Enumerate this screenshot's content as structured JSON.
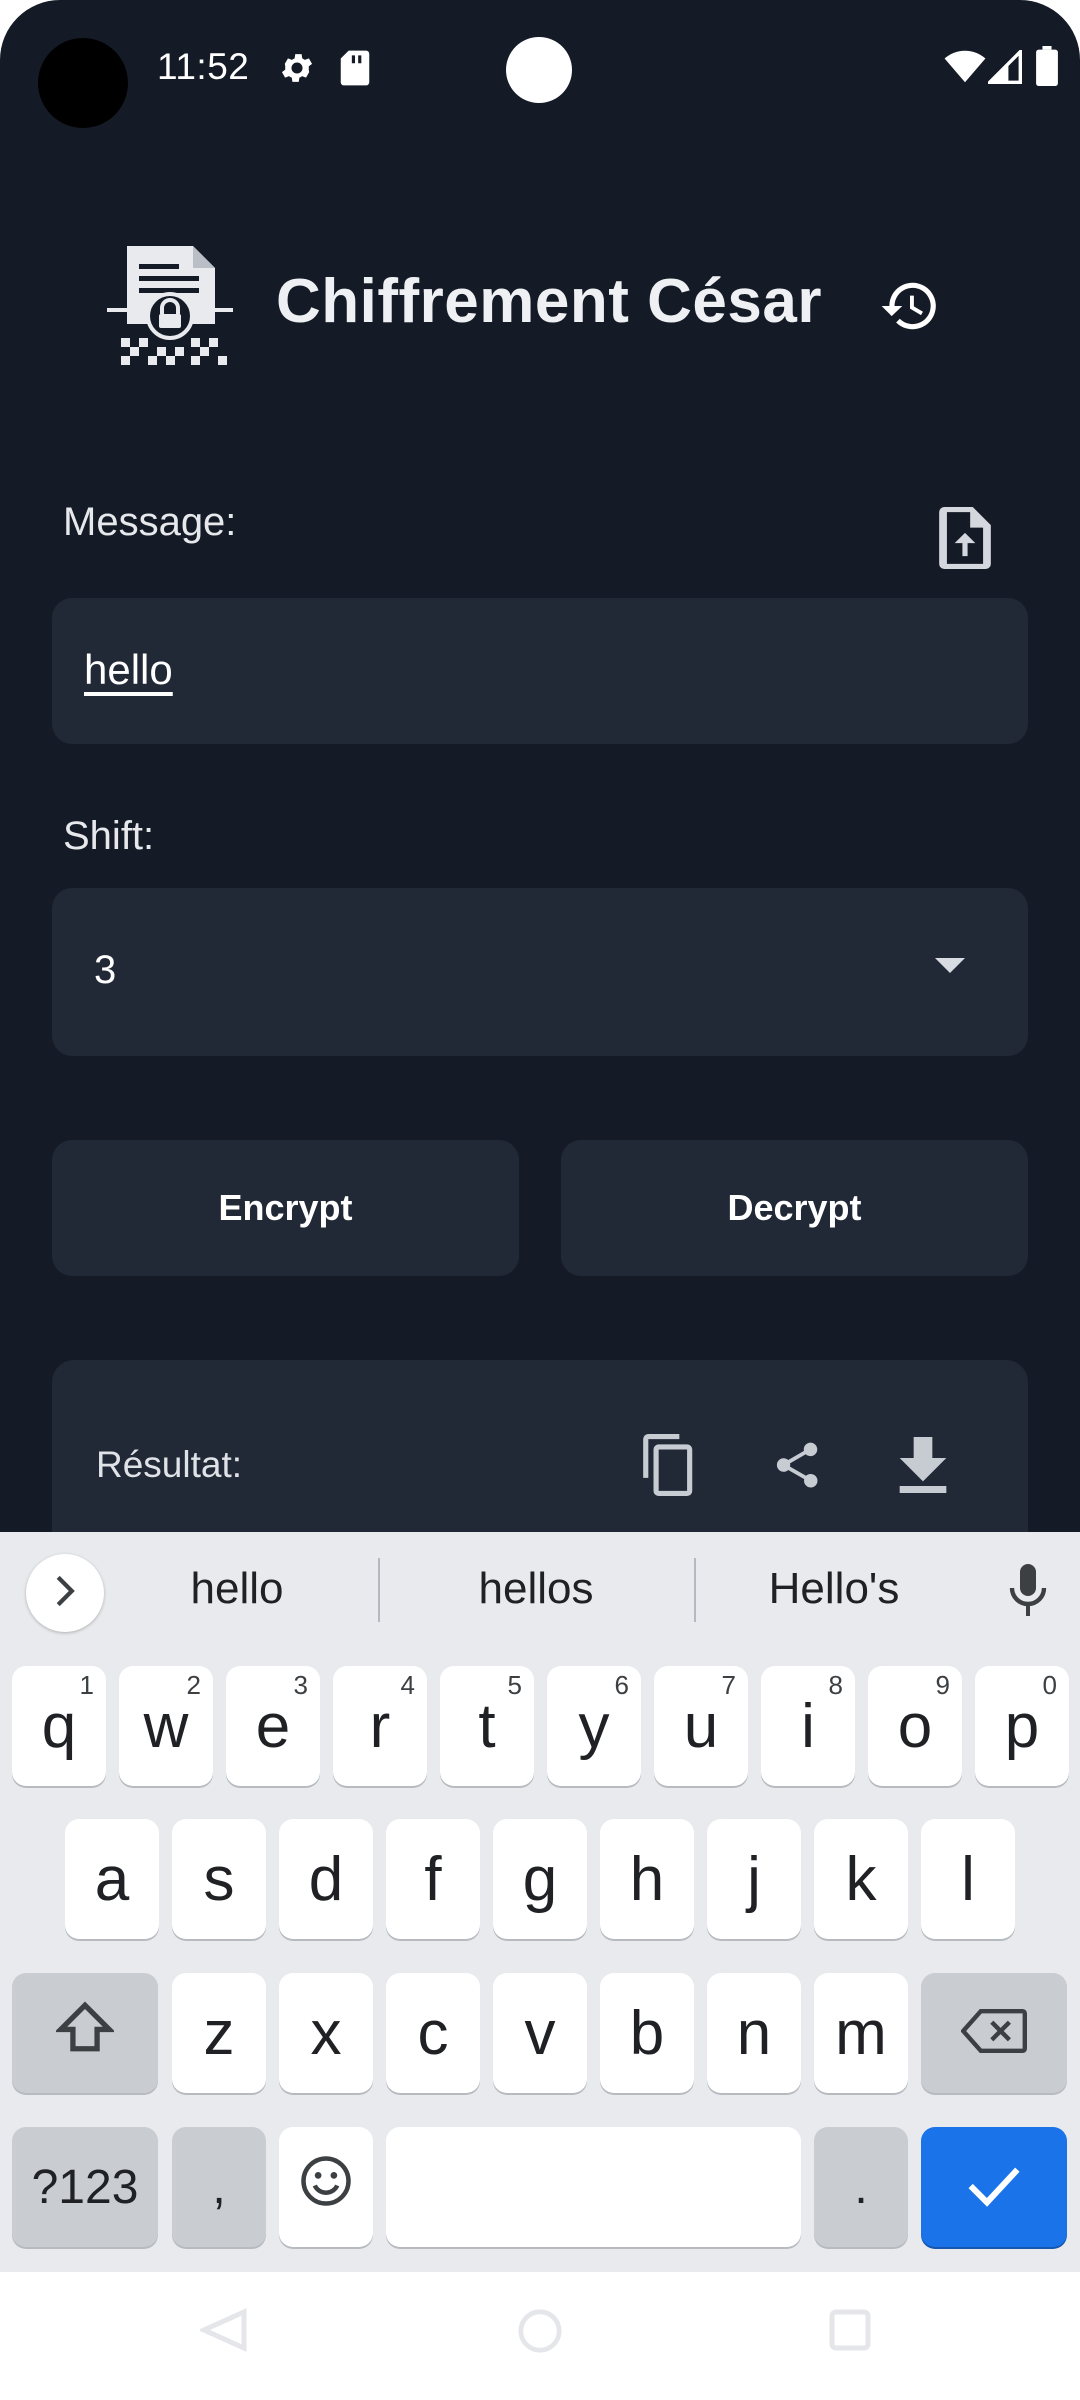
{
  "status_bar": {
    "time": "11:52",
    "icons": [
      "settings-icon",
      "sd-card-icon",
      "wifi-icon",
      "signal-icon",
      "battery-icon"
    ]
  },
  "header": {
    "title": "Chiffrement César",
    "logo": "encrypted-document-logo",
    "history_icon": "history-icon"
  },
  "form": {
    "message_label": "Message:",
    "message_value": "hello",
    "upload_icon": "upload-file-icon",
    "shift_label": "Shift:",
    "shift_value": "3",
    "encrypt_label": "Encrypt",
    "decrypt_label": "Decrypt"
  },
  "result": {
    "label": "Résultat:",
    "icons": [
      "copy-icon",
      "share-icon",
      "download-icon"
    ]
  },
  "keyboard": {
    "suggestions": [
      "hello",
      "hellos",
      "Hello's"
    ],
    "row1": [
      {
        "k": "q",
        "h": "1"
      },
      {
        "k": "w",
        "h": "2"
      },
      {
        "k": "e",
        "h": "3"
      },
      {
        "k": "r",
        "h": "4"
      },
      {
        "k": "t",
        "h": "5"
      },
      {
        "k": "y",
        "h": "6"
      },
      {
        "k": "u",
        "h": "7"
      },
      {
        "k": "i",
        "h": "8"
      },
      {
        "k": "o",
        "h": "9"
      },
      {
        "k": "p",
        "h": "0"
      }
    ],
    "row2": [
      "a",
      "s",
      "d",
      "f",
      "g",
      "h",
      "j",
      "k",
      "l"
    ],
    "row3": [
      "z",
      "x",
      "c",
      "v",
      "b",
      "n",
      "m"
    ],
    "symbols_label": "?123",
    "comma": ",",
    "period": ".",
    "colors": {
      "enter": "#1a73e8",
      "background": "#e8eaed"
    }
  },
  "theme": {
    "background": "#151b26",
    "surface": "#212836",
    "text": "#ffffff"
  }
}
